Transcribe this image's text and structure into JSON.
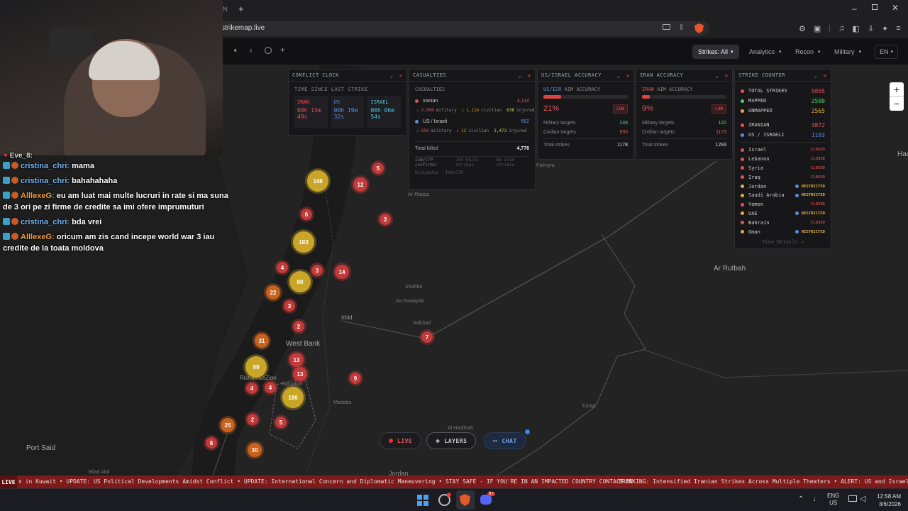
{
  "browser": {
    "tab_fragment": "N",
    "url": "strikemap.live"
  },
  "appbar": {
    "strikes_filter": "Strikes: All",
    "analytics": "Analytics",
    "recon": "Recon",
    "military": "Military",
    "language": "EN"
  },
  "chat": {
    "partial_user": "Eve_8:",
    "messages": [
      {
        "user": "cristina_chri:",
        "text": "mama",
        "color": "#79b7f4"
      },
      {
        "user": "cristina_chri:",
        "text": "bahahahaha",
        "color": "#79b7f4"
      },
      {
        "user": "AlllexeG:",
        "text": "eu am luat mai multe lucruri in rate si ma suna de 3 ori pe zi firme de credite sa imi ofere imprumuturi",
        "color": "#f0a040"
      },
      {
        "user": "cristina_chri:",
        "text": "bda vrei",
        "color": "#79b7f4"
      },
      {
        "user": "AlllexeG:",
        "text": "oricum am zis cand incepe world war 3 iau credite de la toata moldova",
        "color": "#f0a040"
      }
    ]
  },
  "conflict_clock": {
    "title": "CONFLICT CLOCK",
    "subtitle": "TIME SINCE LAST STRIKE",
    "timers": [
      {
        "label": "IRAN",
        "line1": "00h 13m",
        "line2": "49s",
        "color": "#e05555"
      },
      {
        "label": "US",
        "line1": "00h 19m",
        "line2": "32s",
        "color": "#5b8de0"
      },
      {
        "label": "ISRAEL",
        "line1": "00h 06m",
        "line2": "54s",
        "color": "#4ec6d8"
      }
    ]
  },
  "casualties": {
    "title": "CASUALTIES",
    "subtitle": "CASUALTIES",
    "iranian_label": "Iranian",
    "iranian_total": "4,114",
    "iranian_military": "3,000",
    "iranian_civilian": "1,114",
    "iranian_injured": "638",
    "us_label": "US / Israeli",
    "us_total": "662",
    "us_military": "650",
    "us_civilian": "12",
    "us_injured": "1,473",
    "military_word": "military",
    "civilian_word": "civilian",
    "injured_word": "injured",
    "total_killed_label": "Total killed",
    "total_killed": "4,776",
    "confirms_label": "ISW/CTP confirms:",
    "confirms_us": "165 US/IL strikes",
    "confirms_iran": "86 Iran strikes",
    "source1": "Wikipedia",
    "source2": "ISW/CTP"
  },
  "us_accuracy": {
    "title": "US/ISRAEL ACCURACY",
    "aim_label_colored": "US/ISR",
    "aim_label_rest": "AIM ACCURACY",
    "percent": "21%",
    "percent_value": 21,
    "rating": "LOW",
    "military_label": "Military targets",
    "military": "248",
    "civilian_label": "Civilian targets",
    "civilian": "930",
    "total_label": "Total strikes",
    "total": "1178"
  },
  "iran_accuracy": {
    "title": "IRAN ACCURACY",
    "aim_label_colored": "IRAN",
    "aim_label_rest": "AIM ACCURACY",
    "percent": "9%",
    "percent_value": 9,
    "rating": "LOW",
    "military_label": "Military targets",
    "military": "120",
    "civilian_label": "Civilian targets",
    "civilian": "1173",
    "total_label": "Total strikes",
    "total": "1293"
  },
  "strike_counter": {
    "title": "STRIKE COUNTER",
    "totals": [
      {
        "label": "TOTAL STRIKES",
        "value": "5865",
        "color": "#e05555",
        "dot": "#e05555"
      },
      {
        "label": "MAPPED",
        "value": "2500",
        "color": "#4fd06a",
        "dot": "#4fd06a"
      },
      {
        "label": "UNMAPPED",
        "value": "2565",
        "color": "#e0b040",
        "dot": "#e0b040"
      },
      {
        "label": "IRANIAN",
        "value": "3872",
        "color": "#e05555",
        "dot": "#e05555"
      },
      {
        "label": "US / ISRAELI",
        "value": "1193",
        "color": "#5b8de0",
        "dot": "#5b8de0"
      }
    ],
    "countries": [
      {
        "name": "Israel",
        "status": "CLOSED",
        "dot": "#e05555",
        "color": "#c44"
      },
      {
        "name": "Lebanon",
        "status": "CLOSED",
        "dot": "#e05555",
        "color": "#c44"
      },
      {
        "name": "Syria",
        "status": "CLOSED",
        "dot": "#e05555",
        "color": "#c44"
      },
      {
        "name": "Iraq",
        "status": "CLOSED",
        "dot": "#e05555",
        "color": "#c44"
      },
      {
        "name": "Jordan",
        "status": "RESTRICTED",
        "dot": "#e0b040",
        "color": "#e0b040"
      },
      {
        "name": "Saudi Arabia",
        "status": "RESTRICTED",
        "dot": "#e0b040",
        "color": "#e0b040"
      },
      {
        "name": "Yemen",
        "status": "CLOSED",
        "dot": "#e05555",
        "color": "#c44"
      },
      {
        "name": "UAE",
        "status": "RESTRICTED",
        "dot": "#e0b040",
        "color": "#e0b040"
      },
      {
        "name": "Bahrain",
        "status": "CLOSED",
        "dot": "#e05555",
        "color": "#c44"
      },
      {
        "name": "Oman",
        "status": "RESTRICTED",
        "dot": "#e0b040",
        "color": "#e0b040"
      }
    ],
    "view_details": "View Details →"
  },
  "map": {
    "zoom_in": "+",
    "zoom_out": "−",
    "places": [
      {
        "name": "Ar Rutbah",
        "size": "big"
      },
      {
        "name": "Irbid",
        "size": "mid"
      },
      {
        "name": "West Bank",
        "size": "big"
      },
      {
        "name": "Port Said",
        "size": "big"
      },
      {
        "name": "Rishon LeZion",
        "size": "mid"
      },
      {
        "name": "Ramallah",
        "size": "sm"
      },
      {
        "name": "Madaba",
        "size": "sm"
      },
      {
        "name": "Ar-Raqqa",
        "size": "sm"
      },
      {
        "name": "Shahba",
        "size": "sm"
      },
      {
        "name": "As-Suwayda",
        "size": "sm"
      },
      {
        "name": "Salkhad",
        "size": "sm"
      },
      {
        "name": "Turayf",
        "size": "sm"
      },
      {
        "name": "Al Hadithah",
        "size": "sm"
      },
      {
        "name": "Jordan",
        "size": "mid"
      },
      {
        "name": "Hac",
        "size": "mid"
      },
      {
        "name": "Bilad Abd",
        "size": "sm"
      },
      {
        "name": "Palmyra",
        "size": "sm"
      }
    ],
    "clusters": [
      "5",
      "148",
      "12",
      "6",
      "3",
      "183",
      "4",
      "3",
      "14",
      "80",
      "22",
      "3",
      "2",
      "7",
      "31",
      "99",
      "13",
      "13",
      "9",
      "4",
      "4",
      "186",
      "2",
      "5",
      "25",
      "8",
      "30"
    ]
  },
  "bottom_controls": {
    "live": "LIVE",
    "layers": "LAYERS",
    "chat": "CHAT"
  },
  "ticker": {
    "badge": "LIVE",
    "text1": "s in Kuwait • UPDATE: US Political Developments Amidst Conflict • UPDATE: International Concern and Diplomatic Maneuvering • STAY SAFE - IF YOU'RE IN AN IMPACTED COUNTRY CONTACT ME",
    "text2": "BREAKING: Intensified Iranian Strikes Across Multiple Theaters • ALERT: US and Israeli Coun"
  },
  "taskbar": {
    "lang1": "ENG",
    "lang2": "US",
    "time": "12:58 AM",
    "date": "3/6/2026",
    "discord_badge": "9+"
  },
  "colors": {
    "accent_red": "#c23a3a",
    "ticker": "#7d1a1a"
  }
}
